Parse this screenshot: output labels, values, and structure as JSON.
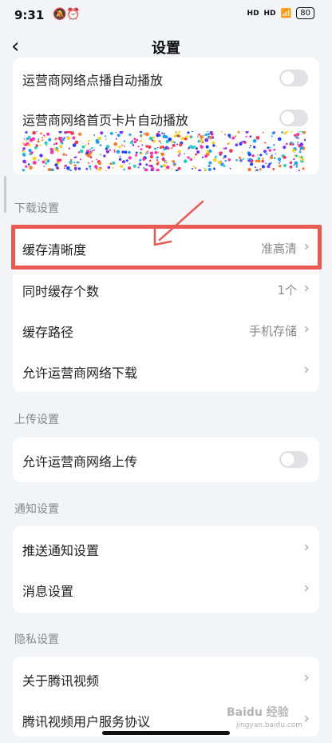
{
  "status": {
    "time": "9:31",
    "left_icons": "🔕⏰",
    "net1": "HD",
    "net2": "HD",
    "wifi": "📶",
    "battery": "80"
  },
  "nav": {
    "back_icon": "‹",
    "title": "设置"
  },
  "top_card": {
    "rows": [
      {
        "label": "运营商网络点播自动播放"
      },
      {
        "label": "运营商网络首页卡片自动播放"
      }
    ]
  },
  "download": {
    "section": "下载设置",
    "rows": [
      {
        "label": "缓存清晰度",
        "value": "准高清"
      },
      {
        "label": "同时缓存个数",
        "value": "1个"
      },
      {
        "label": "缓存路径",
        "value": "手机存储"
      },
      {
        "label": "允许运营商网络下载",
        "value": ""
      }
    ]
  },
  "upload": {
    "section": "上传设置",
    "rows": [
      {
        "label": "允许运营商网络上传"
      }
    ]
  },
  "notify": {
    "section": "通知设置",
    "rows": [
      {
        "label": "推送通知设置"
      },
      {
        "label": "消息设置"
      }
    ]
  },
  "privacy": {
    "section": "隐私设置",
    "rows": [
      {
        "label": "关于腾讯视频"
      },
      {
        "label": "腾讯视频用户服务协议"
      }
    ]
  },
  "chevron": "›",
  "annotation_color": "#ea5a52",
  "watermark": {
    "main": "Baidu 经验",
    "sub": "jingyan.baidu.com"
  }
}
